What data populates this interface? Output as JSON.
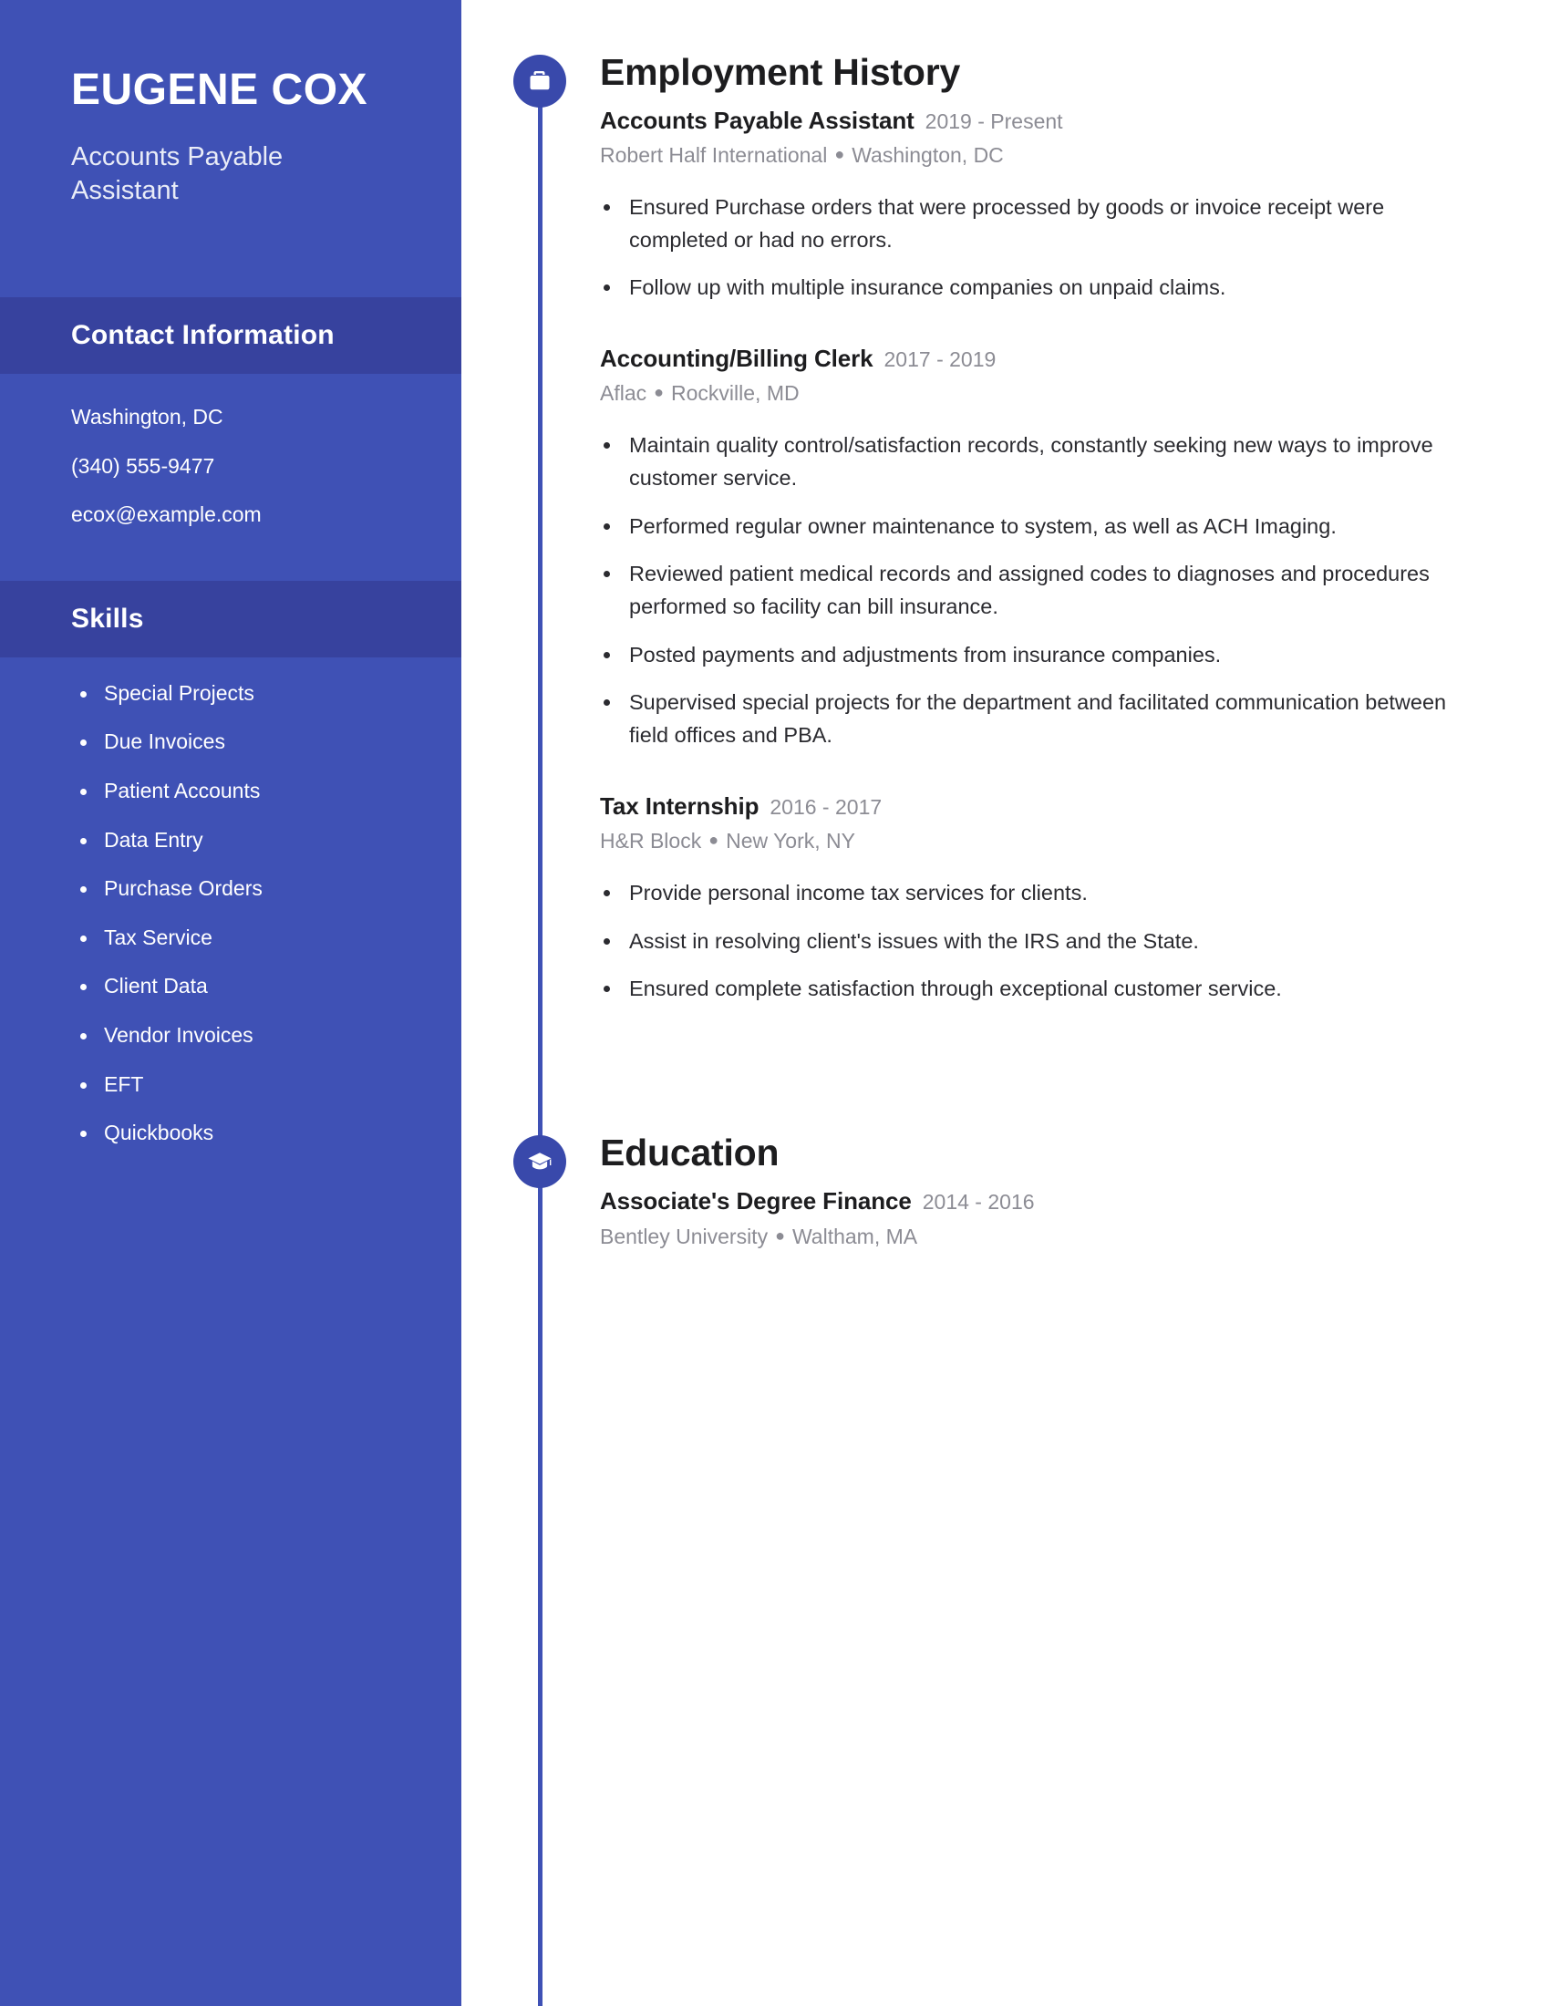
{
  "theme": {
    "sidebar_bg": "#3f51b5",
    "sidebar_header_bg": "#37429e",
    "accent": "#3949ab",
    "text_dark": "#1d1d1f",
    "text_muted": "#8c8c94"
  },
  "sidebar": {
    "full_name": "EUGENE COX",
    "job_title": "Accounts Payable Assistant",
    "contact": {
      "heading": "Contact Information",
      "lines": [
        "Washington, DC",
        "(340) 555-9477",
        "ecox@example.com"
      ]
    },
    "skills": {
      "heading": "Skills",
      "items": [
        "Special Projects",
        "Due Invoices",
        "Patient Accounts",
        "Data Entry",
        "Purchase Orders",
        "Tax Service",
        "Client Data",
        "Vendor Invoices",
        "EFT",
        "Quickbooks"
      ]
    }
  },
  "main": {
    "employment": {
      "heading": "Employment History",
      "icon": "briefcase-icon",
      "entries": [
        {
          "role": "Accounts Payable Assistant",
          "dates": "2019 - Present",
          "company": "Robert Half International",
          "location": "Washington, DC",
          "bullets": [
            "Ensured Purchase orders that were processed by goods or invoice receipt were completed or had no errors.",
            "Follow up with multiple insurance companies on unpaid claims."
          ]
        },
        {
          "role": "Accounting/Billing Clerk",
          "dates": "2017 - 2019",
          "company": "Aflac",
          "location": "Rockville, MD",
          "bullets": [
            "Maintain quality control/satisfaction records, constantly seeking new ways to improve customer service.",
            "Performed regular owner maintenance to system, as well as ACH Imaging.",
            "Reviewed patient medical records and assigned codes to diagnoses and procedures performed so facility can bill insurance.",
            "Posted payments and adjustments from insurance companies.",
            "Supervised special projects for the department and facilitated communication between field offices and PBA."
          ]
        },
        {
          "role": "Tax Internship",
          "dates": "2016 - 2017",
          "company": "H&R Block",
          "location": "New York, NY",
          "bullets": [
            "Provide personal income tax services for clients.",
            "Assist in resolving client's issues with the IRS and the State.",
            "Ensured complete satisfaction through exceptional customer service."
          ]
        }
      ]
    },
    "education": {
      "heading": "Education",
      "icon": "graduation-cap-icon",
      "entries": [
        {
          "degree": "Associate's Degree Finance",
          "dates": "2014 - 2016",
          "school": "Bentley University",
          "location": "Waltham, MA"
        }
      ]
    }
  }
}
